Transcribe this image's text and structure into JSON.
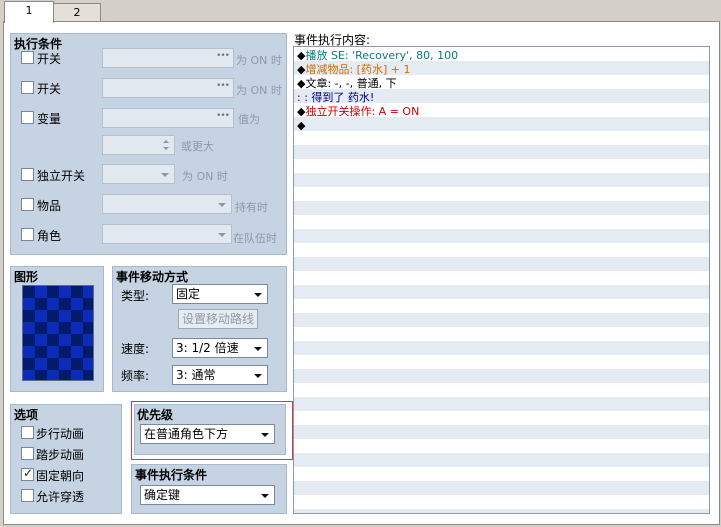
{
  "tabs": [
    {
      "label": "1"
    },
    {
      "label": "2"
    }
  ],
  "conditions": {
    "title": "执行条件",
    "switch1": {
      "label": "开关",
      "suffix": "为 ON 时"
    },
    "switch2": {
      "label": "开关",
      "suffix": "为 ON 时"
    },
    "variable": {
      "label": "变量",
      "suffix": "值为",
      "suffix2": "或更大"
    },
    "self_switch": {
      "label": "独立开关",
      "suffix": "为 ON 时"
    },
    "item": {
      "label": "物品",
      "suffix": "持有时"
    },
    "actor": {
      "label": "角色",
      "suffix": "在队伍时"
    }
  },
  "graphic": {
    "title": "图形"
  },
  "movement": {
    "title": "事件移动方式",
    "type_label": "类型:",
    "type_value": "固定",
    "route_button": "设置移动路线",
    "speed_label": "速度:",
    "speed_value": "3: 1/2 倍速",
    "freq_label": "频率:",
    "freq_value": "3: 通常"
  },
  "options": {
    "title": "选项",
    "items": [
      {
        "label": "步行动画",
        "checked": false
      },
      {
        "label": "踏步动画",
        "checked": false
      },
      {
        "label": "固定朝向",
        "checked": true
      },
      {
        "label": "允许穿透",
        "checked": false
      }
    ]
  },
  "priority": {
    "title": "优先级",
    "value": "在普通角色下方"
  },
  "trigger": {
    "title": "事件执行条件",
    "value": "确定键"
  },
  "contents": {
    "title": "事件执行内容:",
    "lines": [
      {
        "bullet": "◆",
        "text": "播放 SE: 'Recovery', 80, 100",
        "color": "#007f7f"
      },
      {
        "bullet": "◆",
        "text": "增减物品: [药水] + 1",
        "color": "#d36b00"
      },
      {
        "bullet": "◆",
        "text": "文章: -, -, 普通, 下",
        "color": "#000000"
      },
      {
        "bullet": "",
        "text": ":      : 得到了 药水!",
        "color": "#00008b"
      },
      {
        "bullet": "◆",
        "text": "独立开关操作: A = ON",
        "color": "#cc0000"
      },
      {
        "bullet": "◆",
        "text": "",
        "color": "#000000"
      }
    ]
  }
}
